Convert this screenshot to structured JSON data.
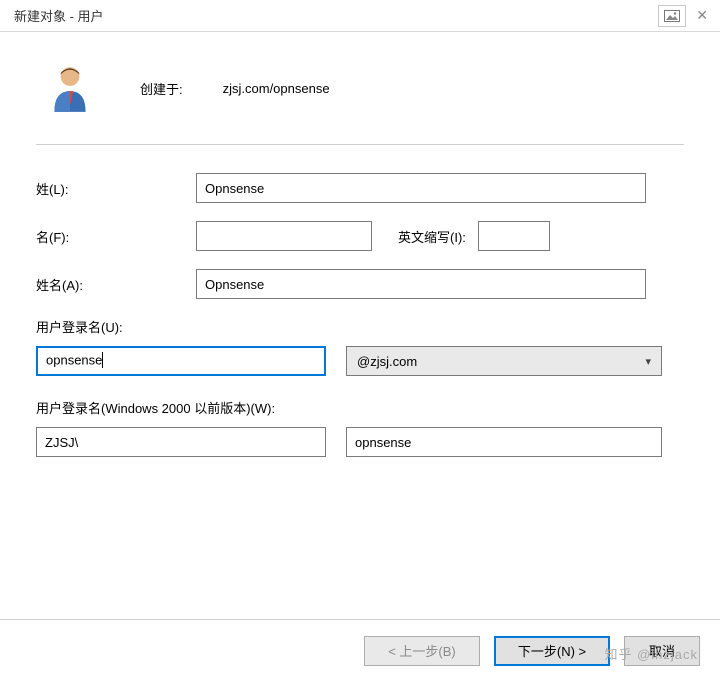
{
  "window": {
    "title": "新建对象 - 用户"
  },
  "header": {
    "created_label": "创建于:",
    "created_path": "zjsj.com/opnsense"
  },
  "form": {
    "surname_label": "姓(L):",
    "surname_value": "Opnsense",
    "givenname_label": "名(F):",
    "givenname_value": "",
    "initials_label": "英文缩写(I):",
    "initials_value": "",
    "fullname_label": "姓名(A):",
    "fullname_value": "Opnsense",
    "userlogon_label": "用户登录名(U):",
    "userlogon_value": "opnsense",
    "domain_selected": "@zjsj.com",
    "userlogon_pre2000_label": "用户登录名(Windows 2000 以前版本)(W):",
    "pre2000_domain": "ZJSJ\\",
    "pre2000_user": "opnsense"
  },
  "buttons": {
    "back": "< 上一步(B)",
    "next": "下一步(N) >",
    "cancel": "取消"
  },
  "watermark": "知乎 @lhzjack"
}
